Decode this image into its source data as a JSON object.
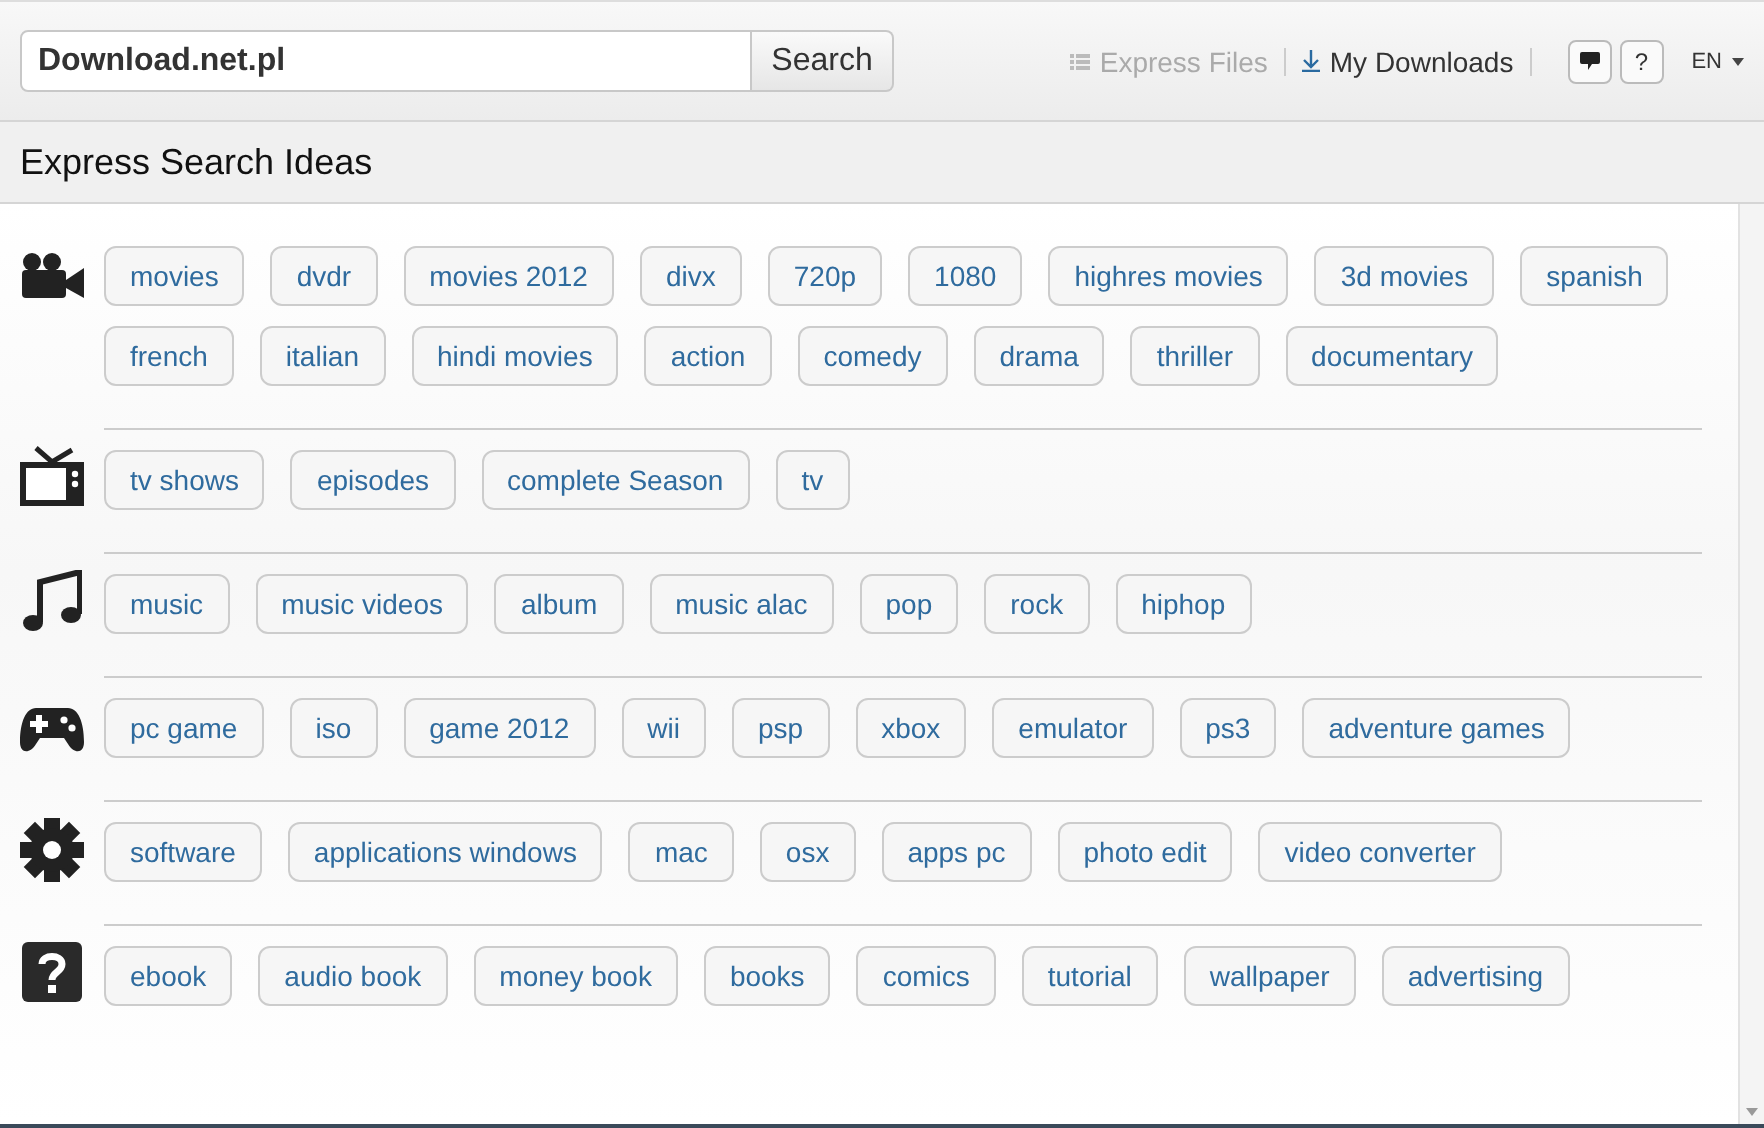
{
  "search": {
    "value": "Download.net.pl",
    "button": "Search"
  },
  "nav": [
    {
      "label": "Express Files",
      "kind": "files",
      "disabled": true
    },
    {
      "label": "My Downloads",
      "kind": "downloads",
      "disabled": false
    }
  ],
  "tools": [
    {
      "kind": "chat"
    },
    {
      "kind": "help",
      "label": "?"
    }
  ],
  "language": "EN",
  "section_title": "Express Search Ideas",
  "categories": [
    {
      "kind": "video",
      "tags": [
        "movies",
        "dvdr",
        "movies 2012",
        "divx",
        "720p",
        "1080",
        "highres movies",
        "3d movies",
        "spanish",
        "french",
        "italian",
        "hindi movies",
        "action",
        "comedy",
        "drama",
        "thriller",
        "documentary"
      ]
    },
    {
      "kind": "tv",
      "tags": [
        "tv shows",
        "episodes",
        "complete Season",
        "tv"
      ]
    },
    {
      "kind": "music",
      "tags": [
        "music",
        "music videos",
        "album",
        "music alac",
        "pop",
        "rock",
        "hiphop"
      ]
    },
    {
      "kind": "game",
      "tags": [
        "pc game",
        "iso",
        "game 2012",
        "wii",
        "psp",
        "xbox",
        "emulator",
        "ps3",
        "adventure games"
      ]
    },
    {
      "kind": "software",
      "tags": [
        "software",
        "applications windows",
        "mac",
        "osx",
        "apps pc",
        "photo edit",
        "video converter"
      ]
    },
    {
      "kind": "other",
      "tags": [
        "ebook",
        "audio book",
        "money book",
        "books",
        "comics",
        "tutorial",
        "wallpaper",
        "advertising"
      ]
    }
  ]
}
